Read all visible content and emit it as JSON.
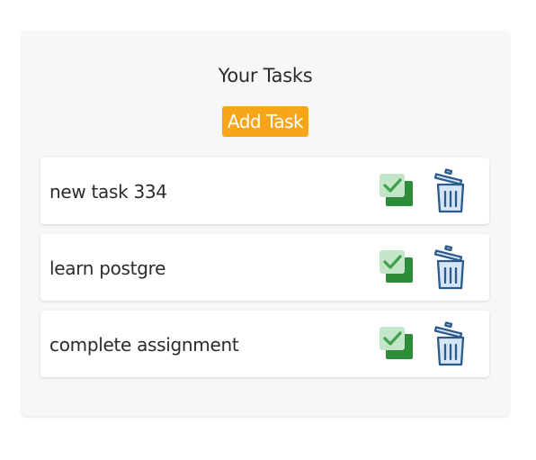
{
  "title": "Your Tasks",
  "add_button_label": "Add Task",
  "tasks": [
    {
      "text": "new task 334"
    },
    {
      "text": "learn postgre"
    },
    {
      "text": "complete assignment"
    }
  ],
  "colors": {
    "accent": "#f9a51a",
    "check_dark": "#2e8b3a",
    "check_light": "#c4e6c8",
    "trash_stroke": "#2c5a8a",
    "trash_fill": "#d4e6f6"
  },
  "icons": {
    "complete": "check-icon",
    "delete": "trash-icon"
  }
}
